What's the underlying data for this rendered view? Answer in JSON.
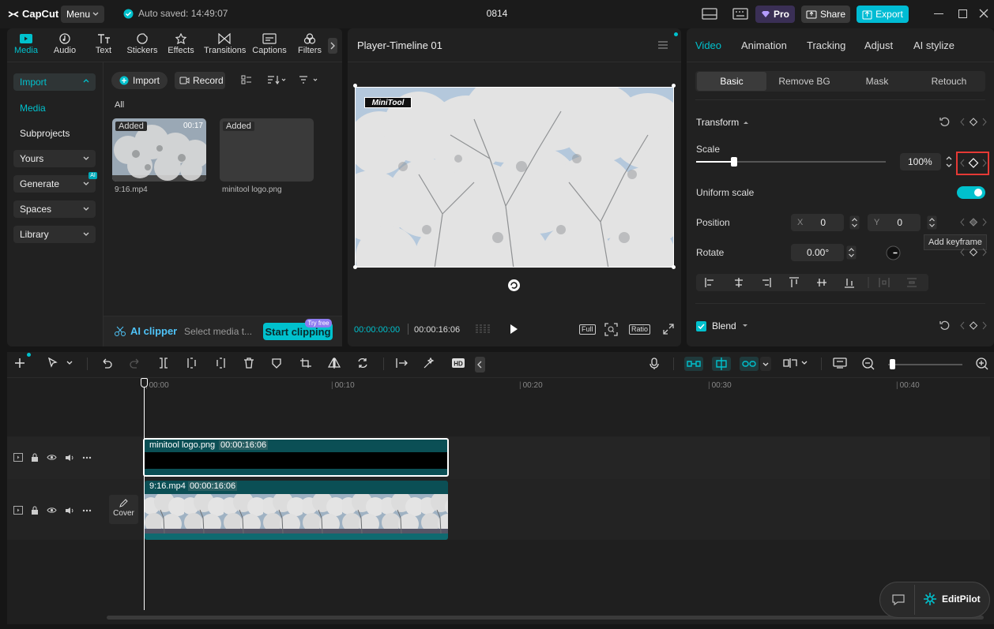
{
  "app": {
    "name": "CapCut",
    "menu_label": "Menu",
    "autosave": "Auto saved: 14:49:07",
    "project_title": "0814",
    "pro_label": "Pro",
    "share_label": "Share",
    "export_label": "Export"
  },
  "left_tabs": [
    {
      "label": "Media",
      "icon": "media-icon"
    },
    {
      "label": "Audio",
      "icon": "audio-icon"
    },
    {
      "label": "Text",
      "icon": "text-icon"
    },
    {
      "label": "Stickers",
      "icon": "stickers-icon"
    },
    {
      "label": "Effects",
      "icon": "effects-icon"
    },
    {
      "label": "Transitions",
      "icon": "transitions-icon"
    },
    {
      "label": "Captions",
      "icon": "captions-icon"
    },
    {
      "label": "Filters",
      "icon": "filters-icon"
    }
  ],
  "sidebar": {
    "import": "Import",
    "media": "Media",
    "subprojects": "Subprojects",
    "yours": "Yours",
    "generate": "Generate",
    "generate_badge": "AI",
    "spaces": "Spaces",
    "library": "Library"
  },
  "media_panel": {
    "import_btn": "Import",
    "record_btn": "Record",
    "filter_all": "All",
    "items": [
      {
        "badge": "Added",
        "duration": "00:17",
        "name": "9:16.mp4"
      },
      {
        "badge": "Added",
        "name": "minitool logo.png"
      }
    ],
    "ai_clipper": "AI clipper",
    "select_media": "Select media t...",
    "start_clipping": "Start clipping",
    "try_free": "Try free"
  },
  "player": {
    "title": "Player-Timeline 01",
    "watermark": "MiniTool",
    "current_time": "00:00:00:00",
    "total_time": "00:00:16:06",
    "full_label": "Full",
    "ratio_label": "Ratio"
  },
  "right_panel": {
    "tabs": [
      "Video",
      "Animation",
      "Tracking",
      "Adjust",
      "AI stylize"
    ],
    "subtabs": [
      "Basic",
      "Remove BG",
      "Mask",
      "Retouch"
    ],
    "transform": "Transform",
    "scale_label": "Scale",
    "scale_value": "100%",
    "scale_fraction": 0.2,
    "uniform_scale": "Uniform scale",
    "position_label": "Position",
    "x_label": "X",
    "x_value": "0",
    "y_label": "Y",
    "y_value": "0",
    "rotate_label": "Rotate",
    "rotate_value": "0.00°",
    "tooltip": "Add keyframe",
    "blend": "Blend"
  },
  "timeline": {
    "ruler": [
      "00:00",
      "00:10",
      "00:20",
      "00:30",
      "00:40"
    ],
    "cover_label": "Cover",
    "clips": [
      {
        "name": "minitool logo.png",
        "duration": "00:00:16:06"
      },
      {
        "name": "9:16.mp4",
        "duration": "00:00:16:06"
      }
    ],
    "editpilot": "EditPilot",
    "zoom_fraction": 0.0
  },
  "colors": {
    "accent": "#00c1cd",
    "export": "#00bcd4",
    "highlight_box": "#e53935",
    "clip_teal": "#0e5a5e"
  }
}
